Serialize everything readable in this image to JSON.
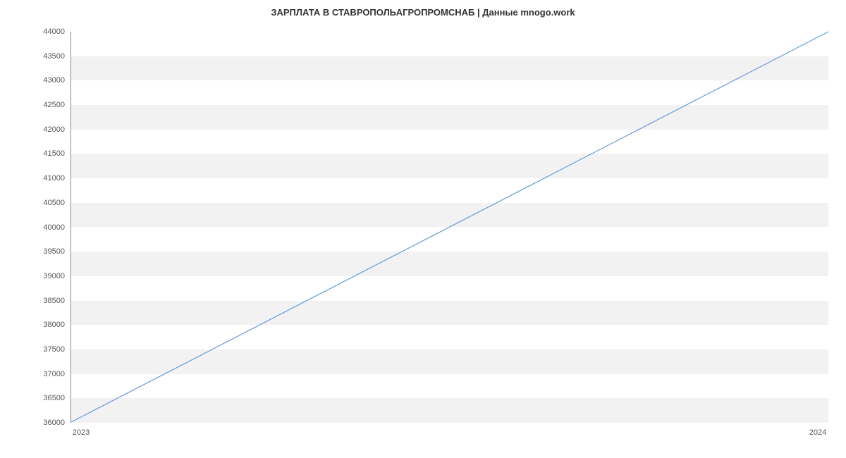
{
  "chart_data": {
    "type": "line",
    "title": "ЗАРПЛАТА В СТАВРОПОЛЬАГРОПРОМСНАБ | Данные mnogo.work",
    "xlabel": "",
    "ylabel": "",
    "x": [
      "2023",
      "2024"
    ],
    "values": [
      36000,
      44000
    ],
    "xlim": [
      "2023",
      "2024"
    ],
    "ylim": [
      36000,
      44000
    ],
    "y_ticks": [
      36000,
      36500,
      37000,
      37500,
      38000,
      38500,
      39000,
      39500,
      40000,
      40500,
      41000,
      41500,
      42000,
      42500,
      43000,
      43500,
      44000
    ],
    "x_ticks": [
      "2023",
      "2024"
    ],
    "line_color": "#6699dd",
    "band_color": "#f2f2f2"
  }
}
